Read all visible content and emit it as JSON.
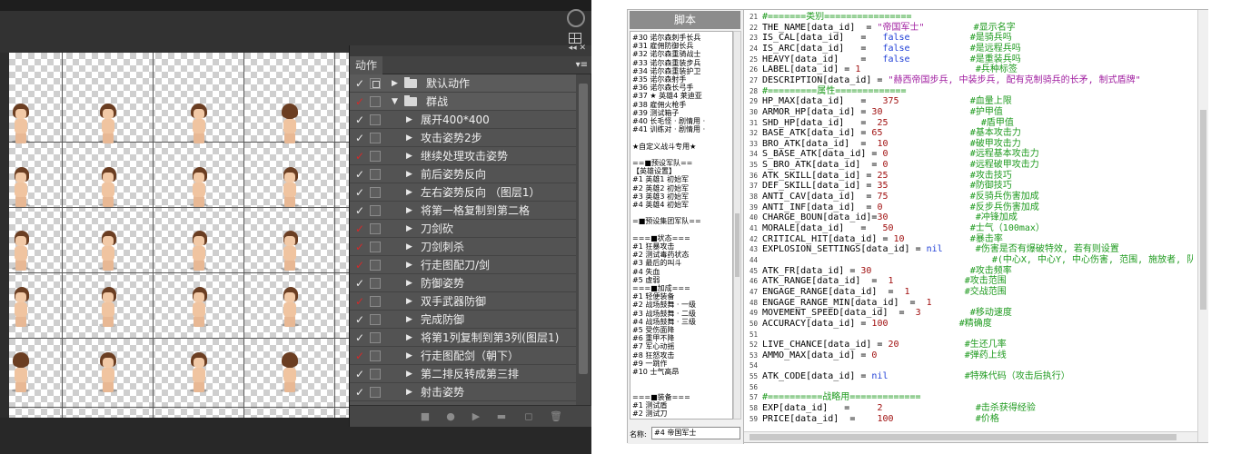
{
  "photoshop": {
    "actions_panel": {
      "tab_label": "动作",
      "panel_menu_icon": "panel-menu-icon",
      "collapse_icon": "double-arrow-icon",
      "rows": [
        {
          "label": "默认动作",
          "type": "set",
          "expanded": false,
          "check": "white",
          "dialog": true
        },
        {
          "label": "群战",
          "type": "set",
          "expanded": true,
          "check": "red",
          "dialog": false
        },
        {
          "label": "展开400*400",
          "type": "action",
          "check": "white"
        },
        {
          "label": "攻击姿势2步",
          "type": "action",
          "check": "white"
        },
        {
          "label": "继续处理攻击姿势",
          "type": "action",
          "check": "red"
        },
        {
          "label": "前后姿势反向",
          "type": "action",
          "check": "white"
        },
        {
          "label": "左右姿势反向 （图层1）",
          "type": "action",
          "check": "white"
        },
        {
          "label": "将第一格复制到第二格",
          "type": "action",
          "check": "white"
        },
        {
          "label": "刀剑砍",
          "type": "action",
          "check": "red"
        },
        {
          "label": "刀剑刺杀",
          "type": "action",
          "check": "red"
        },
        {
          "label": "行走图配刀/剑",
          "type": "action",
          "check": "red"
        },
        {
          "label": "防御姿势",
          "type": "action",
          "check": "white"
        },
        {
          "label": "双手武器防御",
          "type": "action",
          "check": "red"
        },
        {
          "label": "完成防御",
          "type": "action",
          "check": "white"
        },
        {
          "label": "将第1列复制到第3列(图层1)",
          "type": "action",
          "check": "white"
        },
        {
          "label": "行走图配剑（朝下）",
          "type": "action",
          "check": "red"
        },
        {
          "label": "第二排反转成第三排",
          "type": "action",
          "check": "white"
        },
        {
          "label": "射击姿势",
          "type": "action",
          "check": "white"
        }
      ]
    }
  },
  "editor": {
    "title": "脚本",
    "list_items": [
      "#30 诺尔森刺手长兵",
      "#31 雇佣防御长兵",
      "#32 诺尔森重骑战士",
      "#33 诺尔森重装步兵",
      "#34 诺尔森重装护卫",
      "#35 诺尔森射手",
      "#36 诺尔森长弓手",
      "#37 ★ 英雄4 莱迪亚",
      "#38 雇佣火枪手",
      "#39 测试箱子",
      "#40 长毛怪 · 剧情用 ·",
      "#41 训练对 · 剧情用 ·",
      "",
      "★自定义战斗专用★",
      "",
      "==■预设军队==",
      "【英雄设置】",
      "#1 英雄1 初始军",
      "#2 英雄2 初始军",
      "#3 英雄3 初始军",
      "#4 英雄4 初始军",
      "",
      "=■预设集团军队==",
      "",
      "===■状态===",
      "#1 狂暴攻击",
      "#2 测试毒药状态",
      "#3 最后的叫斗",
      "#4 失血",
      "#5 虚弱",
      "===■加成===",
      "#1 轻便装备",
      "#2 战场鼓舞 · 一级",
      "#3 战场鼓舞 · 二级",
      "#4 战场鼓舞 · 三级",
      "#5 受伤面降",
      "#6 重甲不降",
      "#7 军心动摇",
      "#8 狂怒攻击",
      "#9 一跳作",
      "#10 士气高昂",
      "",
      "",
      "===■装备===",
      "#1 测试盾",
      "#2 测试刀"
    ],
    "name_label": "名称:",
    "name_value": "#4 帝国军士",
    "code_lines": [
      {
        "n": "21",
        "parts": [
          {
            "t": "#=======类别================",
            "c": "c"
          }
        ]
      },
      {
        "n": "22",
        "parts": [
          {
            "t": "THE_NAME[data_id]  = ",
            "c": "nm"
          },
          {
            "t": "\"帝国军士\"",
            "c": "s"
          },
          {
            "t": "         #显示名字",
            "c": "c"
          }
        ]
      },
      {
        "n": "23",
        "parts": [
          {
            "t": "IS_CAL[data_id]   =   ",
            "c": "nm"
          },
          {
            "t": "false",
            "c": "k"
          },
          {
            "t": "           #是骑兵吗",
            "c": "c"
          }
        ]
      },
      {
        "n": "24",
        "parts": [
          {
            "t": "IS_ARC[data_id]   =   ",
            "c": "nm"
          },
          {
            "t": "false",
            "c": "k"
          },
          {
            "t": "           #是远程兵吗",
            "c": "c"
          }
        ]
      },
      {
        "n": "25",
        "parts": [
          {
            "t": "HEAVY[data_id]    =   ",
            "c": "nm"
          },
          {
            "t": "false",
            "c": "k"
          },
          {
            "t": "           #是重装兵吗",
            "c": "c"
          }
        ]
      },
      {
        "n": "26",
        "parts": [
          {
            "t": "LABEL[data_id] = ",
            "c": "nm"
          },
          {
            "t": "1",
            "c": "n"
          },
          {
            "t": "                     #兵种标签",
            "c": "c"
          }
        ]
      },
      {
        "n": "27",
        "parts": [
          {
            "t": "DESCRIPTION[data_id] = ",
            "c": "nm"
          },
          {
            "t": "\"赫西帝国步兵, 中装步兵, 配有克制骑兵的长矛, 制式盾牌\"",
            "c": "s"
          }
        ]
      },
      {
        "n": "28",
        "parts": [
          {
            "t": "#=========属性=============",
            "c": "c"
          }
        ]
      },
      {
        "n": "29",
        "parts": [
          {
            "t": "HP_MAX[data_id]   =   ",
            "c": "nm"
          },
          {
            "t": "375",
            "c": "n"
          },
          {
            "t": "             #血量上限",
            "c": "c"
          }
        ]
      },
      {
        "n": "30",
        "parts": [
          {
            "t": "ARMOR_HP[data_id] = ",
            "c": "nm"
          },
          {
            "t": "30",
            "c": "n"
          },
          {
            "t": "                #护甲值",
            "c": "c"
          }
        ]
      },
      {
        "n": "31",
        "parts": [
          {
            "t": "SHD_HP[data_id]   =  ",
            "c": "nm"
          },
          {
            "t": "25",
            "c": "n"
          },
          {
            "t": "                 #盾甲值",
            "c": "c"
          }
        ]
      },
      {
        "n": "32",
        "parts": [
          {
            "t": "BASE_ATK[data_id] = ",
            "c": "nm"
          },
          {
            "t": "65",
            "c": "n"
          },
          {
            "t": "                #基本攻击力",
            "c": "c"
          }
        ]
      },
      {
        "n": "33",
        "parts": [
          {
            "t": "BRO_ATK[data_id]  =  ",
            "c": "nm"
          },
          {
            "t": "10",
            "c": "n"
          },
          {
            "t": "               #破甲攻击力",
            "c": "c"
          }
        ]
      },
      {
        "n": "34",
        "parts": [
          {
            "t": "S_BASE_ATK[data_id] = ",
            "c": "nm"
          },
          {
            "t": "0",
            "c": "n"
          },
          {
            "t": "               #远程基本攻击力",
            "c": "c"
          }
        ]
      },
      {
        "n": "35",
        "parts": [
          {
            "t": "S_BRO_ATK[data_id]  = ",
            "c": "nm"
          },
          {
            "t": "0",
            "c": "n"
          },
          {
            "t": "               #远程破甲攻击力",
            "c": "c"
          }
        ]
      },
      {
        "n": "36",
        "parts": [
          {
            "t": "ATK_SKILL[data_id] = ",
            "c": "nm"
          },
          {
            "t": "25",
            "c": "n"
          },
          {
            "t": "               #攻击技巧",
            "c": "c"
          }
        ]
      },
      {
        "n": "37",
        "parts": [
          {
            "t": "DEF_SKILL[data_id] = ",
            "c": "nm"
          },
          {
            "t": "35",
            "c": "n"
          },
          {
            "t": "               #防御技巧",
            "c": "c"
          }
        ]
      },
      {
        "n": "38",
        "parts": [
          {
            "t": "ANTI_CAV[data_id]  = ",
            "c": "nm"
          },
          {
            "t": "75",
            "c": "n"
          },
          {
            "t": "               #反骑兵伤害加成",
            "c": "c"
          }
        ]
      },
      {
        "n": "39",
        "parts": [
          {
            "t": "ANTI_INF[data_id]  = ",
            "c": "nm"
          },
          {
            "t": "0",
            "c": "n"
          },
          {
            "t": "                #反步兵伤害加成",
            "c": "c"
          }
        ]
      },
      {
        "n": "40",
        "parts": [
          {
            "t": "CHARGE_BOUN[data_id]=",
            "c": "nm"
          },
          {
            "t": "30",
            "c": "n"
          },
          {
            "t": "                #冲锋加成",
            "c": "c"
          }
        ]
      },
      {
        "n": "41",
        "parts": [
          {
            "t": "MORALE[data_id]   =   ",
            "c": "nm"
          },
          {
            "t": "50",
            "c": "n"
          },
          {
            "t": "              #士气（100max）",
            "c": "c"
          }
        ]
      },
      {
        "n": "42",
        "parts": [
          {
            "t": "CRITICAL_HIT[data_id] = ",
            "c": "nm"
          },
          {
            "t": "10",
            "c": "n"
          },
          {
            "t": "            #暴击率",
            "c": "c"
          }
        ]
      },
      {
        "n": "43",
        "parts": [
          {
            "t": "EXPLOSION_SETTINGS[data_id] = ",
            "c": "nm"
          },
          {
            "t": "nil",
            "c": "k"
          },
          {
            "t": "      #伤害是否有爆破特效, 若有则设置",
            "c": "c"
          }
        ]
      },
      {
        "n": "44",
        "parts": [
          {
            "t": "                                          #(中心X, 中心Y, 中心伤害, 范围, 施放者, 队",
            "c": "c"
          }
        ]
      },
      {
        "n": "45",
        "parts": [
          {
            "t": "ATK_FR[data_id] = ",
            "c": "nm"
          },
          {
            "t": "30",
            "c": "n"
          },
          {
            "t": "                  #攻击频率",
            "c": "c"
          }
        ]
      },
      {
        "n": "46",
        "parts": [
          {
            "t": "ATK_RANGE[data_id]  =  ",
            "c": "nm"
          },
          {
            "t": "1",
            "c": "n"
          },
          {
            "t": "             #攻击范围",
            "c": "c"
          }
        ]
      },
      {
        "n": "47",
        "parts": [
          {
            "t": "ENGAGE_RANGE[data_id]  =  ",
            "c": "nm"
          },
          {
            "t": "1",
            "c": "n"
          },
          {
            "t": "          #交战范围",
            "c": "c"
          }
        ]
      },
      {
        "n": "48",
        "parts": [
          {
            "t": "ENGAGE_RANGE_MIN[data_id]  =  ",
            "c": "nm"
          },
          {
            "t": "1",
            "c": "n"
          }
        ]
      },
      {
        "n": "49",
        "parts": [
          {
            "t": "MOVEMENT_SPEED[data_id]  =  ",
            "c": "nm"
          },
          {
            "t": "3",
            "c": "n"
          },
          {
            "t": "         #移动速度",
            "c": "c"
          }
        ]
      },
      {
        "n": "50",
        "parts": [
          {
            "t": "ACCURACY[data_id] = ",
            "c": "nm"
          },
          {
            "t": "100",
            "c": "n"
          },
          {
            "t": "             #精确度",
            "c": "c"
          }
        ]
      },
      {
        "n": "51",
        "parts": [
          {
            "t": "",
            "c": "nm"
          }
        ]
      },
      {
        "n": "52",
        "parts": [
          {
            "t": "LIVE_CHANCE[data_id] = ",
            "c": "nm"
          },
          {
            "t": "20",
            "c": "n"
          },
          {
            "t": "            #生还几率",
            "c": "c"
          }
        ]
      },
      {
        "n": "53",
        "parts": [
          {
            "t": "AMMO_MAX[data_id] = ",
            "c": "nm"
          },
          {
            "t": "0",
            "c": "n"
          },
          {
            "t": "                #弹药上线",
            "c": "c"
          }
        ]
      },
      {
        "n": "54",
        "parts": [
          {
            "t": "",
            "c": "nm"
          }
        ]
      },
      {
        "n": "55",
        "parts": [
          {
            "t": "ATK_CODE[data_id] = ",
            "c": "nm"
          },
          {
            "t": "nil",
            "c": "k"
          },
          {
            "t": "              #特殊代码（攻击后执行）",
            "c": "c"
          }
        ]
      },
      {
        "n": "56",
        "parts": [
          {
            "t": "",
            "c": "nm"
          }
        ]
      },
      {
        "n": "57",
        "parts": [
          {
            "t": "#==========战略用=============",
            "c": "c"
          }
        ]
      },
      {
        "n": "58",
        "parts": [
          {
            "t": "EXP[data_id]   =     ",
            "c": "nm"
          },
          {
            "t": "2",
            "c": "n"
          },
          {
            "t": "                 #击杀获得经验",
            "c": "c"
          }
        ]
      },
      {
        "n": "59",
        "parts": [
          {
            "t": "PRICE[data_id]  =    ",
            "c": "nm"
          },
          {
            "t": "100",
            "c": "n"
          },
          {
            "t": "               #价格",
            "c": "c"
          }
        ]
      }
    ]
  }
}
